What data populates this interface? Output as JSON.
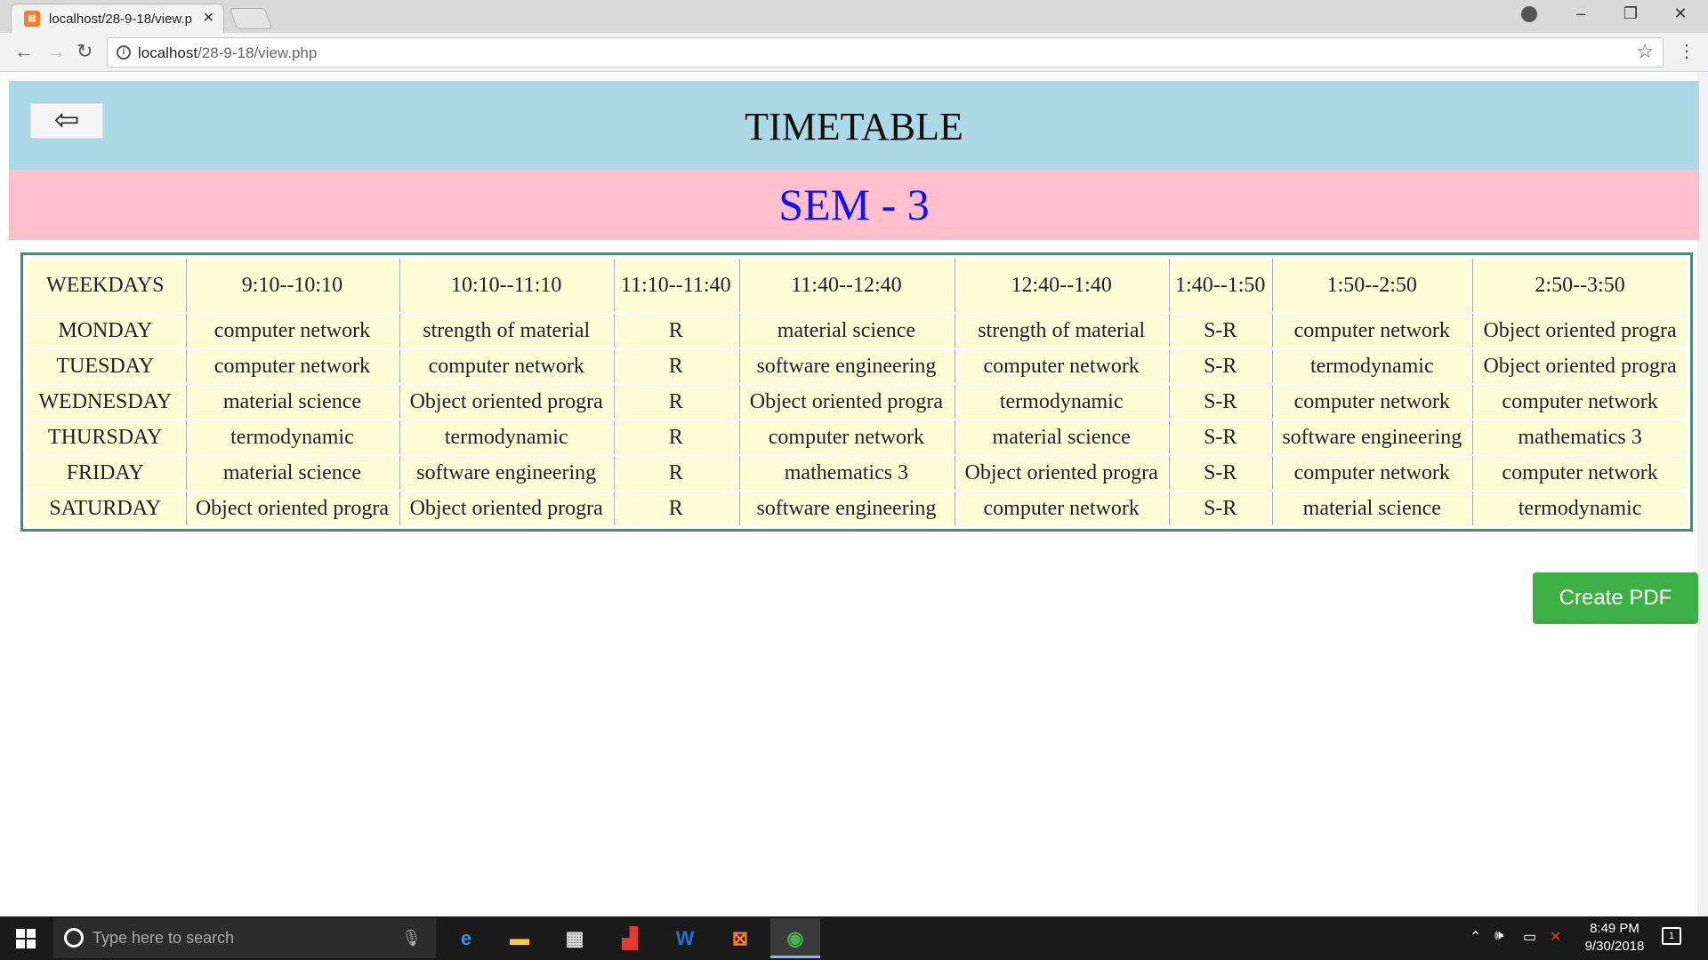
{
  "browser": {
    "tab_title": "localhost/28-9-18/view.p",
    "url_host": "localhost",
    "url_path": "/28-9-18/view.php"
  },
  "page": {
    "title": "TIMETABLE",
    "subtitle": "SEM - 3",
    "back_symbol": "⇦",
    "create_pdf_label": "Create PDF"
  },
  "timetable": {
    "headers": [
      "WEEKDAYS",
      "9:10--10:10",
      "10:10--11:10",
      "11:10--11:40",
      "11:40--12:40",
      "12:40--1:40",
      "1:40--1:50",
      "1:50--2:50",
      "2:50--3:50"
    ],
    "rows": [
      [
        "MONDAY",
        "computer network",
        "strength of material",
        "R",
        "material science",
        "strength of material",
        "S-R",
        "computer network",
        "Object oriented progra"
      ],
      [
        "TUESDAY",
        "computer network",
        "computer network",
        "R",
        "software engineering",
        "computer network",
        "S-R",
        "termodynamic",
        "Object oriented progra"
      ],
      [
        "WEDNESDAY",
        "material science",
        "Object oriented progra",
        "R",
        "Object oriented progra",
        "termodynamic",
        "S-R",
        "computer network",
        "computer network"
      ],
      [
        "THURSDAY",
        "termodynamic",
        "termodynamic",
        "R",
        "computer network",
        "material science",
        "S-R",
        "software engineering",
        "mathematics 3"
      ],
      [
        "FRIDAY",
        "material science",
        "software engineering",
        "R",
        "mathematics 3",
        "Object oriented progra",
        "S-R",
        "computer network",
        "computer network"
      ],
      [
        "SATURDAY",
        "Object oriented progra",
        "Object oriented progra",
        "R",
        "software engineering",
        "computer network",
        "S-R",
        "material science",
        "termodynamic"
      ]
    ]
  },
  "taskbar": {
    "search_placeholder": "Type here to search",
    "time": "8:49 PM",
    "date": "9/30/2018",
    "notification_count": "1"
  },
  "colors": {
    "header_band": "#add8e6",
    "sem_band": "#ffc0cb",
    "sem_text": "#1010ff",
    "cell_bg": "#fffdd8",
    "pdf_button": "#3cb043"
  }
}
